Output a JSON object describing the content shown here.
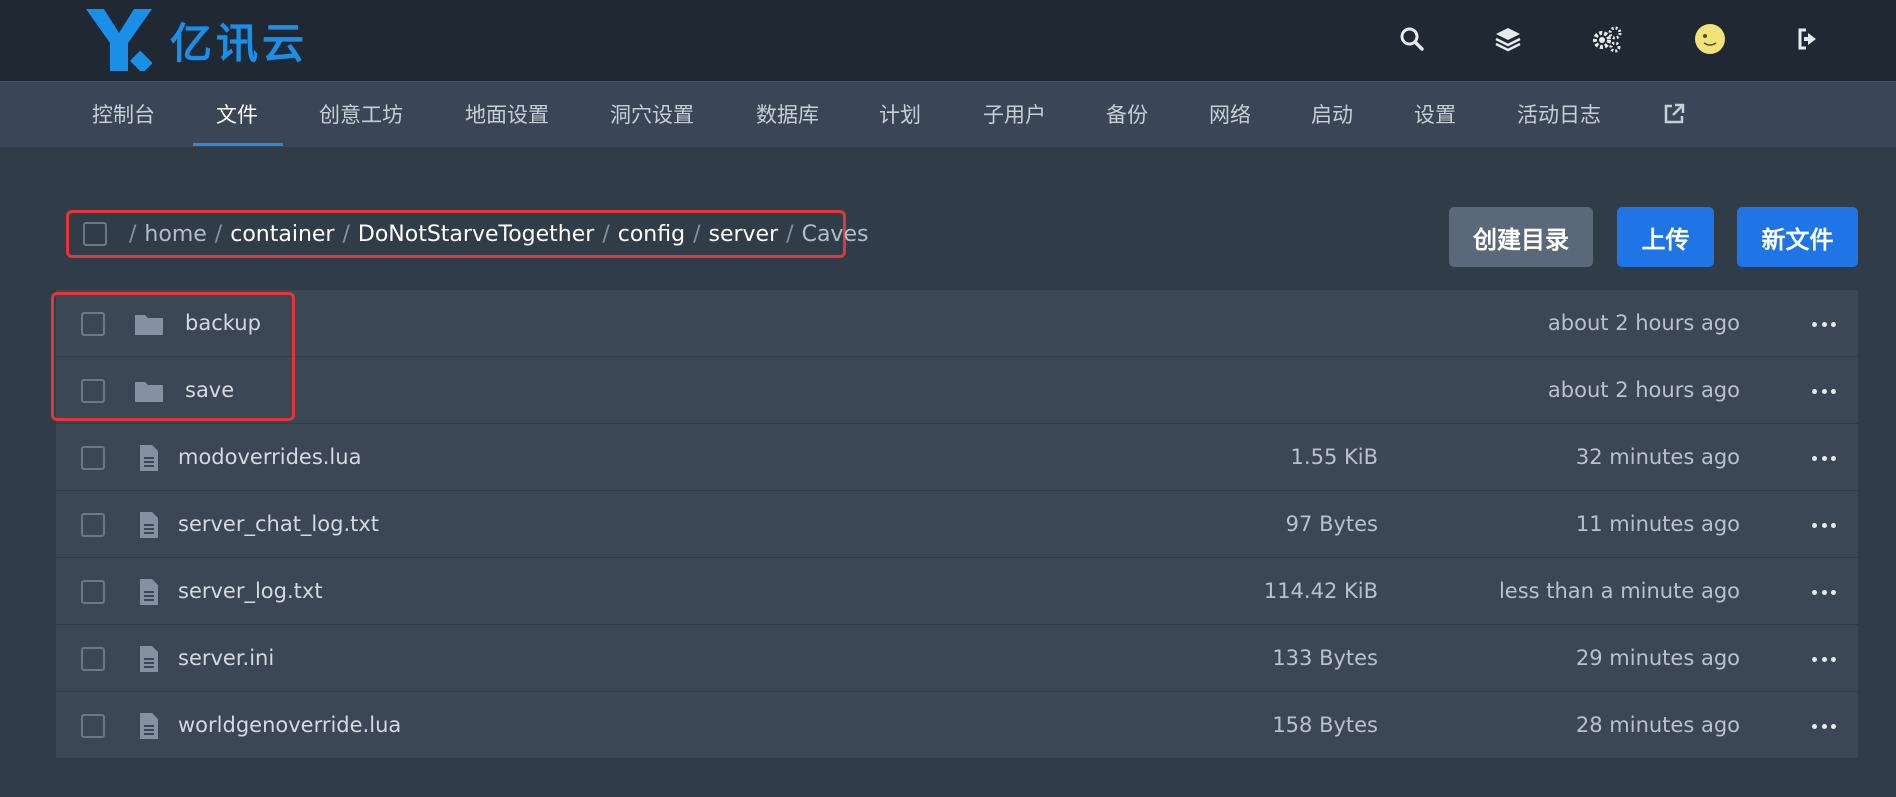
{
  "header": {
    "logo_text": "亿讯云",
    "icons": [
      "search-icon",
      "layers-icon",
      "gears-icon",
      "avatar",
      "logout-icon"
    ]
  },
  "nav": {
    "items": [
      {
        "label": "控制台"
      },
      {
        "label": "文件"
      },
      {
        "label": "创意工坊"
      },
      {
        "label": "地面设置"
      },
      {
        "label": "洞穴设置"
      },
      {
        "label": "数据库"
      },
      {
        "label": "计划"
      },
      {
        "label": "子用户"
      },
      {
        "label": "备份"
      },
      {
        "label": "网络"
      },
      {
        "label": "启动"
      },
      {
        "label": "设置"
      },
      {
        "label": "活动日志"
      }
    ],
    "active_index": 1
  },
  "breadcrumb": {
    "segments": [
      "home",
      "container",
      "DoNotStarveTogether",
      "config",
      "server",
      "Caves"
    ]
  },
  "actions": {
    "create_dir": "创建目录",
    "upload": "上传",
    "new_file": "新文件"
  },
  "files": [
    {
      "name": "backup",
      "type": "folder",
      "size": "",
      "modified": "about 2 hours ago"
    },
    {
      "name": "save",
      "type": "folder",
      "size": "",
      "modified": "about 2 hours ago"
    },
    {
      "name": "modoverrides.lua",
      "type": "file",
      "size": "1.55 KiB",
      "modified": "32 minutes ago"
    },
    {
      "name": "server_chat_log.txt",
      "type": "file",
      "size": "97 Bytes",
      "modified": "11 minutes ago"
    },
    {
      "name": "server_log.txt",
      "type": "file",
      "size": "114.42 KiB",
      "modified": "less than a minute ago"
    },
    {
      "name": "server.ini",
      "type": "file",
      "size": "133 Bytes",
      "modified": "29 minutes ago"
    },
    {
      "name": "worldgenoverride.lua",
      "type": "file",
      "size": "158 Bytes",
      "modified": "28 minutes ago"
    }
  ],
  "colors": {
    "accent": "#1f74e6",
    "highlight": "#e0383a"
  }
}
